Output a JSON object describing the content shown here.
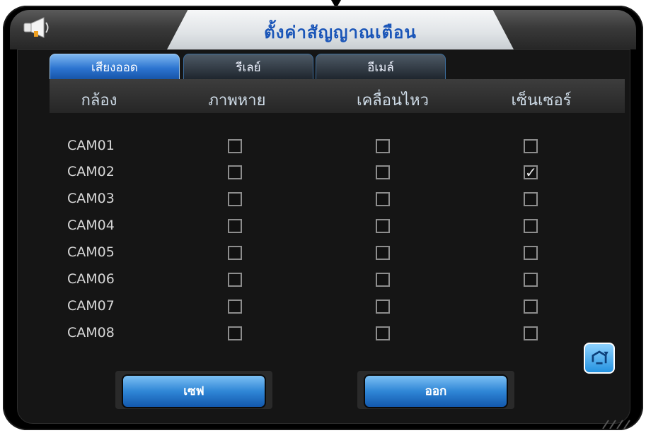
{
  "window": {
    "title": "ตั้งค่าสัญญาณเตือน"
  },
  "tabs": [
    {
      "label": "เสียงออด",
      "active": true
    },
    {
      "label": "รีเลย์",
      "active": false
    },
    {
      "label": "อีเมล์",
      "active": false
    }
  ],
  "columns": {
    "camera": "กล้อง",
    "video_loss": "ภาพหาย",
    "motion": "เคลื่อนไหว",
    "sensor": "เซ็นเซอร์"
  },
  "rows": [
    {
      "camera": "CAM01",
      "video_loss": false,
      "motion": false,
      "sensor": false
    },
    {
      "camera": "CAM02",
      "video_loss": false,
      "motion": false,
      "sensor": true
    },
    {
      "camera": "CAM03",
      "video_loss": false,
      "motion": false,
      "sensor": false
    },
    {
      "camera": "CAM04",
      "video_loss": false,
      "motion": false,
      "sensor": false
    },
    {
      "camera": "CAM05",
      "video_loss": false,
      "motion": false,
      "sensor": false
    },
    {
      "camera": "CAM06",
      "video_loss": false,
      "motion": false,
      "sensor": false
    },
    {
      "camera": "CAM07",
      "video_loss": false,
      "motion": false,
      "sensor": false
    },
    {
      "camera": "CAM08",
      "video_loss": false,
      "motion": false,
      "sensor": false
    }
  ],
  "buttons": {
    "save": "เซฟ",
    "exit": "ออก"
  },
  "icons": {
    "header": "megaphone-icon",
    "refresh": "refresh-icon"
  },
  "colors": {
    "accent": "#2c74d0",
    "title": "#1a55b8",
    "background": "#000000"
  }
}
